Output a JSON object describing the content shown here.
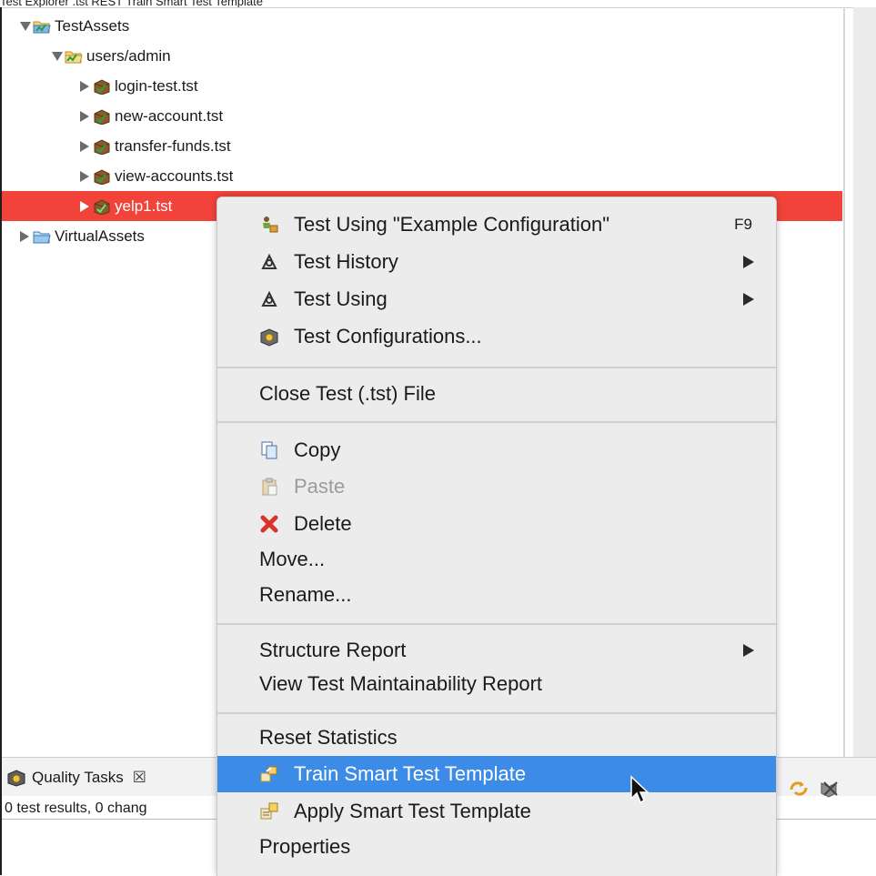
{
  "caption": "Test Explorer .tst REST Train Smart Test Template",
  "tree": {
    "root_label": "TestAssets",
    "folder_label": "users/admin",
    "files": [
      "login-test.tst",
      "new-account.tst",
      "transfer-funds.tst",
      "view-accounts.tst"
    ],
    "selected_file": "yelp1.tst",
    "virtual_label": "VirtualAssets"
  },
  "menu": {
    "test_using_config": "Test Using \"Example Configuration\"",
    "test_using_config_accel": "F9",
    "test_history": "Test History",
    "test_using": "Test Using",
    "test_configurations": "Test Configurations...",
    "close_test": "Close Test (.tst) File",
    "copy": "Copy",
    "paste": "Paste",
    "delete": "Delete",
    "move": "Move...",
    "rename": "Rename...",
    "structure_report": "Structure Report",
    "view_maintainability": "View Test Maintainability Report",
    "reset_statistics": "Reset Statistics",
    "train_template": "Train Smart Test Template",
    "apply_template": "Apply Smart Test Template",
    "properties": "Properties"
  },
  "bottom": {
    "tab_label": "Quality Tasks",
    "tab_close": "☒",
    "status": "0 test results, 0 chang"
  },
  "colors": {
    "selection": "#f2433b",
    "menu_highlight": "#3c8ce7",
    "menu_bg": "#ececec"
  },
  "icons": [
    "folder-icon",
    "test-file-icon",
    "test-run-icon",
    "test-history-icon",
    "configurations-icon",
    "copy-icon",
    "paste-icon",
    "delete-icon",
    "train-template-icon",
    "apply-template-icon",
    "quality-tasks-icon",
    "refresh-icon",
    "clear-icon",
    "cursor-icon"
  ]
}
